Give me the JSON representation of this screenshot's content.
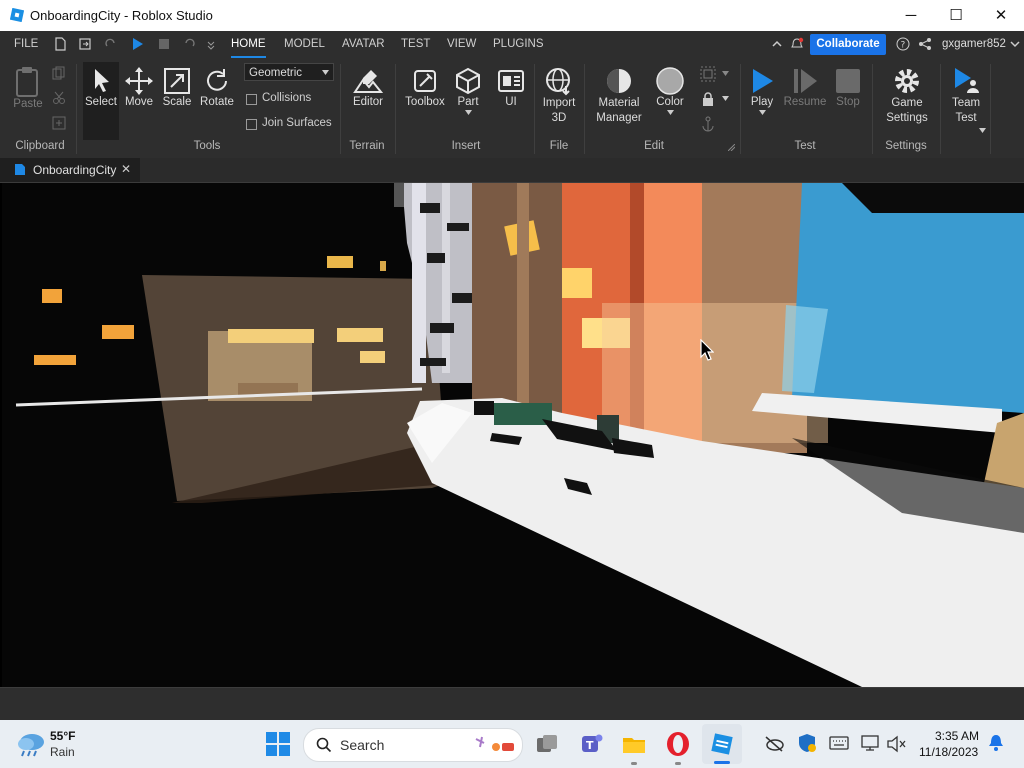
{
  "window": {
    "title": "OnboardingCity - Roblox Studio",
    "min": "─",
    "max": "☐",
    "close": "✕"
  },
  "menubar": {
    "file": "FILE",
    "tabs": [
      "HOME",
      "MODEL",
      "AVATAR",
      "TEST",
      "VIEW",
      "PLUGINS"
    ],
    "active_tab": "HOME",
    "collaborate": "Collaborate",
    "username": "gxgamer852",
    "accent": "#1a73e8"
  },
  "ribbon": {
    "clipboard": {
      "paste": "Paste",
      "label": "Clipboard"
    },
    "tools": {
      "select": "Select",
      "move": "Move",
      "scale": "Scale",
      "rotate": "Rotate",
      "label": "Tools",
      "mode": "Geometric",
      "collisions": "Collisions",
      "join": "Join Surfaces"
    },
    "terrain": {
      "editor": "Editor",
      "label": "Terrain"
    },
    "insert": {
      "toolbox": "Toolbox",
      "part": "Part",
      "ui": "UI",
      "label": "Insert"
    },
    "file": {
      "import1": "Import",
      "import2": "3D",
      "label": "File"
    },
    "edit": {
      "material1": "Material",
      "material2": "Manager",
      "color": "Color",
      "label": "Edit"
    },
    "test": {
      "play": "Play",
      "resume": "Resume",
      "stop": "Stop",
      "label": "Test"
    },
    "settings": {
      "game1": "Game",
      "game2": "Settings",
      "label": "Settings"
    },
    "team": {
      "t1": "Team",
      "t2": "Test"
    }
  },
  "doctab": {
    "name": "OnboardingCity",
    "close": "✕"
  },
  "taskbar": {
    "weather_temp": "55°F",
    "weather_desc": "Rain",
    "search": "Search",
    "time": "3:35 AM",
    "date": "11/18/2023"
  }
}
